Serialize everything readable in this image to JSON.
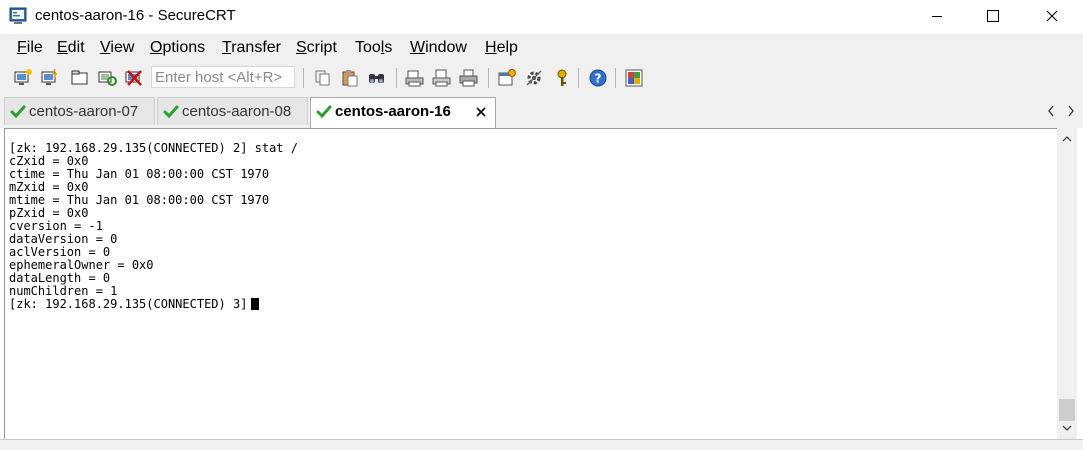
{
  "window": {
    "title": "centos-aaron-16 - SecureCRT",
    "controls": [
      "minimize",
      "maximize",
      "close"
    ]
  },
  "menu": [
    {
      "pre": "",
      "u": "F",
      "post": "ile"
    },
    {
      "pre": "",
      "u": "E",
      "post": "dit"
    },
    {
      "pre": "",
      "u": "V",
      "post": "iew"
    },
    {
      "pre": "",
      "u": "O",
      "post": "ptions"
    },
    {
      "pre": "",
      "u": "T",
      "post": "ransfer"
    },
    {
      "pre": "",
      "u": "S",
      "post": "cript"
    },
    {
      "pre": "Too",
      "u": "l",
      "post": "s"
    },
    {
      "pre": "",
      "u": "W",
      "post": "indow"
    },
    {
      "pre": "",
      "u": "H",
      "post": "elp"
    }
  ],
  "toolbar": {
    "host_placeholder": "Enter host <Alt+R>",
    "icons": [
      "connect-icon",
      "quick-connect-icon",
      "connect-in-tab-icon",
      "reconnect-icon",
      "disconnect-icon",
      "copy-icon",
      "paste-icon",
      "find-icon",
      "print-screen-icon",
      "print-selection-icon",
      "print-icon",
      "session-options-icon",
      "global-options-icon",
      "keymap-icon",
      "help-icon",
      "sftp-icon"
    ]
  },
  "tabs": [
    {
      "label": "centos-aaron-07",
      "active": false
    },
    {
      "label": "centos-aaron-08",
      "active": false
    },
    {
      "label": "centos-aaron-16",
      "active": true
    }
  ],
  "terminal": {
    "lines": [
      "[zk: 192.168.29.135(CONNECTED) 2] stat /",
      "cZxid = 0x0",
      "ctime = Thu Jan 01 08:00:00 CST 1970",
      "mZxid = 0x0",
      "mtime = Thu Jan 01 08:00:00 CST 1970",
      "pZxid = 0x0",
      "cversion = -1",
      "dataVersion = 0",
      "aclVersion = 0",
      "ephemeralOwner = 0x0",
      "dataLength = 0",
      "numChildren = 1"
    ],
    "prompt": "[zk: 192.168.29.135(CONNECTED) 3]"
  },
  "colors": {
    "chrome": "#f0f0f0",
    "tab_check": "#2aa02a",
    "terminal_bg": "#ffffff",
    "terminal_fg": "#000000"
  }
}
